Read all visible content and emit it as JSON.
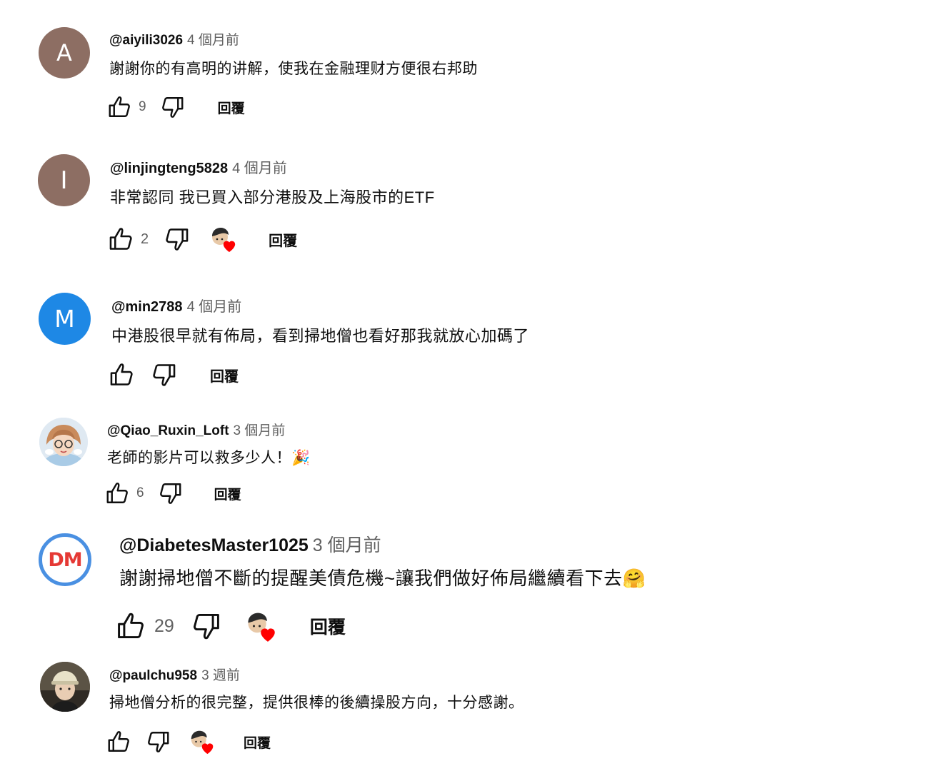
{
  "comments": [
    {
      "author": "@aiyili3026",
      "time": "4 個月前",
      "text": "謝謝你的有高明的讲解，使我在金融理财方便很右邦助",
      "likes": "9",
      "reply_label": "回覆",
      "avatar_letter": "A",
      "avatar_color": "#8d6e63"
    },
    {
      "author": "@linjingteng5828",
      "time": "4 個月前",
      "text": "非常認同 我已買入部分港股及上海股市的ETF",
      "likes": "2",
      "reply_label": "回覆",
      "avatar_letter": "I",
      "avatar_color": "#8d6e63",
      "creator_heart": true
    },
    {
      "author": "@min2788",
      "time": "4 個月前",
      "text": "中港股很早就有佈局，看到掃地僧也看好那我就放心加碼了",
      "likes": "",
      "reply_label": "回覆",
      "avatar_letter": "M",
      "avatar_color": "#1e88e5"
    },
    {
      "author": "@Qiao_Ruxin_Loft",
      "time": "3 個月前",
      "text": "老師的影片可以救多少人！🎉",
      "likes": "6",
      "reply_label": "回覆"
    },
    {
      "author": "@DiabetesMaster1025",
      "time": "3 個月前",
      "text": "謝謝掃地僧不斷的提醒美債危機~讓我們做好佈局繼續看下去🤗",
      "likes": "29",
      "reply_label": "回覆",
      "avatar_letter": "DM",
      "avatar_color": "#e53935",
      "creator_heart": true
    },
    {
      "author": "@paulchu958",
      "time": "3 週前",
      "text": "掃地僧分析的很完整，提供很棒的後續操股方向，十分感謝。",
      "likes": "",
      "reply_label": "回覆",
      "creator_heart": true
    }
  ],
  "icons": {
    "like": "thumb-up-icon",
    "dislike": "thumb-down-icon",
    "heart": "creator-heart-icon"
  },
  "colors": {
    "heart": "#ff0000",
    "secondary_text": "#606060"
  }
}
